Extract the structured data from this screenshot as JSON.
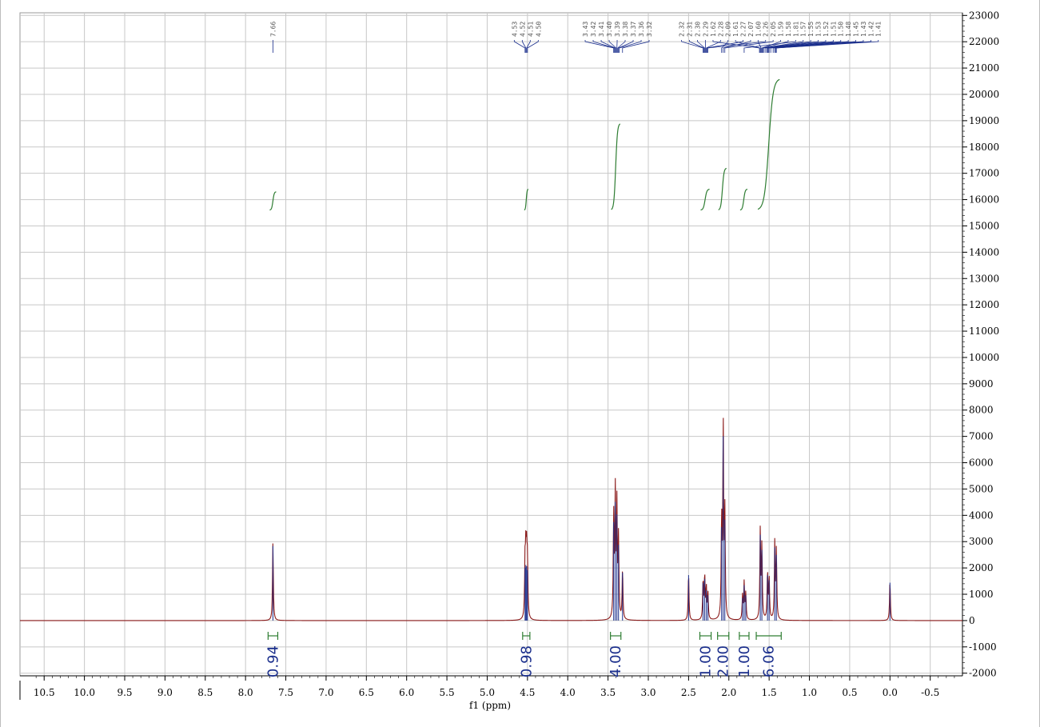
{
  "chart_data": {
    "type": "line",
    "title": "",
    "xlabel": "f1 (ppm)",
    "ylabel": "",
    "xlim": [
      10.8,
      -0.9
    ],
    "ylim": [
      -2100,
      23100
    ],
    "x_inverted": true,
    "grid": true,
    "x_ticks": [
      10.5,
      10.0,
      9.5,
      9.0,
      8.5,
      8.0,
      7.5,
      7.0,
      6.5,
      6.0,
      5.5,
      5.0,
      4.5,
      4.0,
      3.5,
      3.0,
      2.5,
      2.0,
      1.5,
      1.0,
      0.5,
      0.0,
      -0.5
    ],
    "x_tick_labels": [
      "10.5",
      "10.0",
      "9.5",
      "9.0",
      "8.5",
      "8.0",
      "7.5",
      "7.0",
      "6.5",
      "6.0",
      "5.5",
      "5.0",
      "4.5",
      "4.0",
      "3.5",
      "3.0",
      "2.5",
      "2.0",
      "1.5",
      "1.0",
      "0.5",
      "0.0",
      "-0.5"
    ],
    "y_ticks": [
      -2000,
      -1000,
      0,
      1000,
      2000,
      3000,
      4000,
      5000,
      6000,
      7000,
      8000,
      9000,
      10000,
      11000,
      12000,
      13000,
      14000,
      15000,
      16000,
      17000,
      18000,
      19000,
      20000,
      21000,
      22000,
      23000
    ],
    "y_tick_labels": [
      "-2000",
      "-1000",
      "0",
      "1000",
      "2000",
      "3000",
      "4000",
      "5000",
      "6000",
      "7000",
      "8000",
      "9000",
      "10000",
      "11000",
      "12000",
      "13000",
      "14000",
      "15000",
      "16000",
      "17000",
      "18000",
      "19000",
      "20000",
      "21000",
      "22000",
      "23000"
    ],
    "peaks": [
      {
        "x": 7.66,
        "y": 2950
      },
      {
        "x": 4.53,
        "y": 2100
      },
      {
        "x": 4.52,
        "y": 2200
      },
      {
        "x": 4.51,
        "y": 2150
      },
      {
        "x": 4.5,
        "y": 2000
      },
      {
        "x": 3.43,
        "y": 3900
      },
      {
        "x": 3.41,
        "y": 4700
      },
      {
        "x": 3.39,
        "y": 4200
      },
      {
        "x": 3.37,
        "y": 3000
      },
      {
        "x": 3.32,
        "y": 1900
      },
      {
        "x": 2.5,
        "y": 1800
      },
      {
        "x": 2.32,
        "y": 1500
      },
      {
        "x": 2.3,
        "y": 1650
      },
      {
        "x": 2.28,
        "y": 1200
      },
      {
        "x": 2.26,
        "y": 1000
      },
      {
        "x": 2.09,
        "y": 3700
      },
      {
        "x": 2.07,
        "y": 7300
      },
      {
        "x": 2.05,
        "y": 4000
      },
      {
        "x": 1.83,
        "y": 900
      },
      {
        "x": 1.81,
        "y": 1400
      },
      {
        "x": 1.79,
        "y": 1000
      },
      {
        "x": 1.61,
        "y": 3400
      },
      {
        "x": 1.59,
        "y": 2800
      },
      {
        "x": 1.52,
        "y": 1800
      },
      {
        "x": 1.5,
        "y": 1600
      },
      {
        "x": 1.43,
        "y": 2900
      },
      {
        "x": 1.41,
        "y": 2600
      },
      {
        "x": 0.0,
        "y": 1500
      }
    ],
    "integrals": [
      {
        "from": 7.72,
        "to": 7.6,
        "label": "0.94"
      },
      {
        "from": 4.56,
        "to": 4.47,
        "label": "0.98"
      },
      {
        "from": 3.47,
        "to": 3.34,
        "label": "4.00"
      },
      {
        "from": 2.36,
        "to": 2.22,
        "label": "1.00"
      },
      {
        "from": 2.14,
        "to": 2.0,
        "label": "2.00"
      },
      {
        "from": 1.87,
        "to": 1.75,
        "label": "1.00"
      },
      {
        "from": 1.66,
        "to": 1.35,
        "label": "6.06"
      }
    ],
    "integral_curves": [
      {
        "from": 7.7,
        "to": 7.62,
        "y0": 15600,
        "y1": 16300
      },
      {
        "from": 4.54,
        "to": 4.49,
        "y0": 15600,
        "y1": 16400
      },
      {
        "from": 3.46,
        "to": 3.35,
        "y0": 15600,
        "y1": 18900
      },
      {
        "from": 2.35,
        "to": 2.24,
        "y0": 15600,
        "y1": 16400
      },
      {
        "from": 2.13,
        "to": 2.03,
        "y0": 15600,
        "y1": 17200
      },
      {
        "from": 1.86,
        "to": 1.77,
        "y0": 15600,
        "y1": 16400
      },
      {
        "from": 1.64,
        "to": 1.37,
        "y0": 15600,
        "y1": 20600
      }
    ],
    "peak_labels": [
      {
        "x": 7.66,
        "text": "7.66"
      },
      {
        "x": 4.53,
        "text": "4.53"
      },
      {
        "x": 4.52,
        "text": "4.52"
      },
      {
        "x": 4.51,
        "text": "4.51"
      },
      {
        "x": 4.5,
        "text": "4.50"
      },
      {
        "x": 3.43,
        "text": "3.43"
      },
      {
        "x": 3.42,
        "text": "3.42"
      },
      {
        "x": 3.41,
        "text": "3.41"
      },
      {
        "x": 3.4,
        "text": "3.40"
      },
      {
        "x": 3.39,
        "text": "3.39"
      },
      {
        "x": 3.38,
        "text": "3.38"
      },
      {
        "x": 3.37,
        "text": "3.37"
      },
      {
        "x": 3.36,
        "text": "3.36"
      },
      {
        "x": 3.32,
        "text": "3.32"
      },
      {
        "x": 2.32,
        "text": "2.32"
      },
      {
        "x": 2.31,
        "text": "2.31"
      },
      {
        "x": 2.3,
        "text": "2.30"
      },
      {
        "x": 2.29,
        "text": "2.29"
      },
      {
        "x": 2.28,
        "text": "2.28"
      },
      {
        "x": 2.27,
        "text": "2.27"
      },
      {
        "x": 2.26,
        "text": "2.26"
      },
      {
        "x": 2.09,
        "text": "2.09"
      },
      {
        "x": 2.07,
        "text": "2.07"
      },
      {
        "x": 2.05,
        "text": "2.05"
      },
      {
        "x": 1.81,
        "text": "1.81"
      },
      {
        "x": 1.62,
        "text": "1.62"
      },
      {
        "x": 1.61,
        "text": "1.61"
      },
      {
        "x": 1.6,
        "text": "1.60"
      },
      {
        "x": 1.59,
        "text": "1.59"
      },
      {
        "x": 1.58,
        "text": "1.58"
      },
      {
        "x": 1.57,
        "text": "1.57"
      },
      {
        "x": 1.55,
        "text": "1.55"
      },
      {
        "x": 1.53,
        "text": "1.53"
      },
      {
        "x": 1.52,
        "text": "1.52"
      },
      {
        "x": 1.51,
        "text": "1.51"
      },
      {
        "x": 1.5,
        "text": "1.50"
      },
      {
        "x": 1.48,
        "text": "1.48"
      },
      {
        "x": 1.45,
        "text": "1.45"
      },
      {
        "x": 1.43,
        "text": "1.43"
      },
      {
        "x": 1.42,
        "text": "1.42"
      },
      {
        "x": 1.41,
        "text": "1.41"
      }
    ],
    "colors": {
      "spectrum": "#8b1a1a",
      "peak_core": "#1a2e8c",
      "integral": "#2e7d32",
      "integral_label": "#1a2e8c",
      "grid": "#c8c8c8",
      "peak_label_line": "#1a2e8c"
    }
  }
}
